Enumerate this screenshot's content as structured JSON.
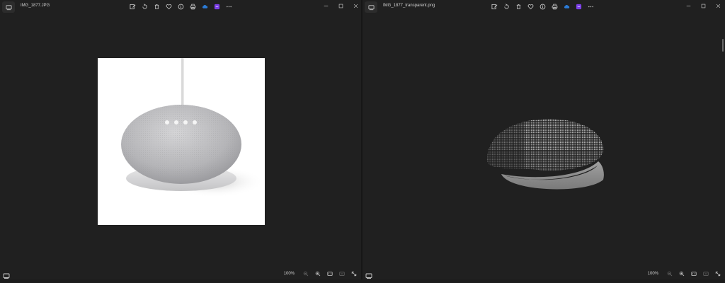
{
  "left_window": {
    "filename": "IMG_1877.JPG",
    "zoom": "100%",
    "toolbar_icons": [
      "edit-icon",
      "rotate-icon",
      "delete-icon",
      "favorite-icon",
      "info-icon",
      "print-icon",
      "onedrive-icon",
      "clipchamp-icon",
      "more-icon"
    ],
    "window_controls": [
      "minimize-icon",
      "maximize-icon",
      "close-icon"
    ]
  },
  "right_window": {
    "filename": "IMG_1877_transparent.png",
    "zoom": "100%",
    "toolbar_icons": [
      "edit-icon",
      "rotate-icon",
      "delete-icon",
      "favorite-icon",
      "info-icon",
      "print-icon",
      "onedrive-icon",
      "clipchamp-icon",
      "more-icon"
    ],
    "window_controls": [
      "minimize-icon",
      "maximize-icon",
      "close-icon"
    ]
  },
  "colors": {
    "background": "#202020",
    "accent_onedrive": "#2b7bd6",
    "accent_clipchamp": "#7b3fe4"
  }
}
